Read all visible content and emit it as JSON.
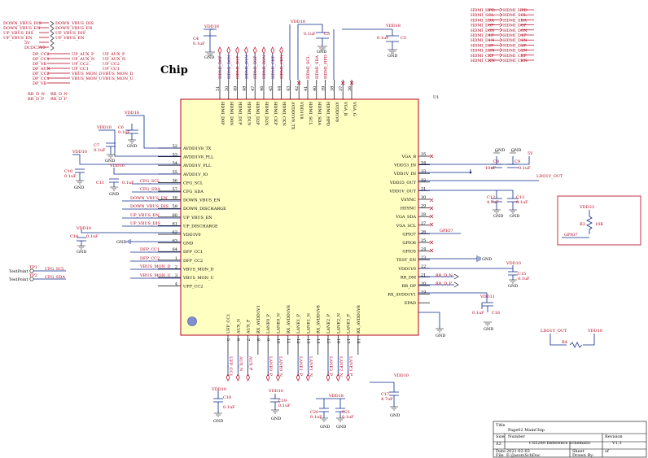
{
  "schematic": {
    "chip_title": "Chip",
    "ref_designator": "U1",
    "left_pins": [
      {
        "num": "52",
        "name": "AVDD1V8_TX"
      },
      {
        "num": "53",
        "name": "AVDD1V8_PLL"
      },
      {
        "num": "54",
        "name": "AVDD1V_PLL"
      },
      {
        "num": "55",
        "name": "AVDD1V_IO"
      },
      {
        "num": "56",
        "name": "CFG_SCL"
      },
      {
        "num": "57",
        "name": "CFG_SDA"
      },
      {
        "num": "58",
        "name": "DOWN_VBUS_EN"
      },
      {
        "num": "59",
        "name": "DOWN_DISCHARGE"
      },
      {
        "num": "60",
        "name": "UP_VBUS_EN"
      },
      {
        "num": "61",
        "name": "UP_DISCHARGE"
      },
      {
        "num": "62",
        "name": "VDD1V0"
      },
      {
        "num": "63",
        "name": "GND"
      },
      {
        "num": "64",
        "name": "DFP_CC1"
      },
      {
        "num": "1",
        "name": "DFP_CC2"
      },
      {
        "num": "2",
        "name": "VBUS_MON_D"
      },
      {
        "num": "3",
        "name": "VBUS_MON_U"
      },
      {
        "num": "4",
        "name": "UFP_CC2"
      }
    ],
    "right_pins": [
      {
        "num": "35",
        "name": "VGA_B"
      },
      {
        "num": "34",
        "name": "VDD33_IN"
      },
      {
        "num": "33",
        "name": "VDD1V_IN"
      },
      {
        "num": "32",
        "name": "VDD33_OUT"
      },
      {
        "num": "31",
        "name": "VDD1V_OUT"
      },
      {
        "num": "30",
        "name": "VSYNC"
      },
      {
        "num": "29",
        "name": "HSYNC"
      },
      {
        "num": "28",
        "name": "VGA_SDA"
      },
      {
        "num": "27",
        "name": "VGA_SCL"
      },
      {
        "num": "26",
        "name": "GPIO7"
      },
      {
        "num": "25",
        "name": "GPIO6"
      },
      {
        "num": "24",
        "name": "GPIO5"
      },
      {
        "num": "23",
        "name": "TEST_EN"
      },
      {
        "num": "22",
        "name": "VDD1V0"
      },
      {
        "num": "21",
        "name": "RR_DM"
      },
      {
        "num": "20",
        "name": "RR_DP"
      },
      {
        "num": "19",
        "name": "RX_AVDD1V1"
      },
      {
        "num": "",
        "name": "EPAD"
      }
    ],
    "top_pins": [
      {
        "num": "51",
        "name": "HDMI_D0P"
      },
      {
        "num": "50",
        "name": "HDMI_D0N"
      },
      {
        "num": "49",
        "name": "HDMI_D1P"
      },
      {
        "num": "48",
        "name": "HDMI_D1N"
      },
      {
        "num": "47",
        "name": "HDMI_D2P"
      },
      {
        "num": "46",
        "name": "HDMI_D2N"
      },
      {
        "num": "45",
        "name": "HDMI_CKP"
      },
      {
        "num": "44",
        "name": "HDMI_CKN"
      },
      {
        "num": "43",
        "name": "AVDD1V8_TX"
      },
      {
        "num": "42",
        "name": "VDD1V8"
      },
      {
        "num": "41",
        "name": "HDMI_SCL"
      },
      {
        "num": "40",
        "name": "HDMI_SDA"
      },
      {
        "num": "39",
        "name": "HDMI_HPD"
      },
      {
        "num": "38",
        "name": "AVDD1V8"
      },
      {
        "num": "37",
        "name": "VGA_R"
      },
      {
        "num": "36",
        "name": "VGA_G"
      }
    ],
    "bottom_pins": [
      {
        "num": "5",
        "name": "UFP_CC1"
      },
      {
        "num": "6",
        "name": "AUX_N"
      },
      {
        "num": "7",
        "name": "AUX_P"
      },
      {
        "num": "8",
        "name": "RX_AVDD1V1"
      },
      {
        "num": "9",
        "name": "LANE0_P"
      },
      {
        "num": "10",
        "name": "LANE0_N"
      },
      {
        "num": "11",
        "name": "RX_AVDD1V8"
      },
      {
        "num": "12",
        "name": "LANE1_P"
      },
      {
        "num": "13",
        "name": "LANE1_N"
      },
      {
        "num": "14",
        "name": "RX_AVDD1V8"
      },
      {
        "num": "15",
        "name": "LANE2_P"
      },
      {
        "num": "16",
        "name": "LANE2_N"
      },
      {
        "num": "17",
        "name": "LANE3_P"
      },
      {
        "num": "18",
        "name": "RX_AVDD1V8"
      }
    ],
    "left_nets": [
      "DOWN_VBUS_DIS",
      "DOWN_VBUS_EN",
      "UP_VBUS_DIS",
      "UP_VBUS_EN",
      "5V",
      "DCDC3V3"
    ],
    "left_nets_2": [
      "DP_CC2",
      "DP_CC1",
      "DP_VB",
      "DP_AUX",
      "UP_AUX_P",
      "UP_AUX_N",
      "UP_CC2",
      "UP_CC1",
      "VBUS_MON_D",
      "VBUS_MON_U"
    ],
    "left_nets_3": [
      "RR_D_N",
      "RR_D_P"
    ],
    "right_nets": [
      "HDMI_HPD",
      "HDMI_SCL",
      "HDMI_SDA",
      "HDMI_D0P",
      "HDMI_D0N",
      "HDMI_D1P",
      "HDMI_D1N",
      "HDMI_D2P",
      "HDMI_D2N",
      "HDMI_CKP",
      "HDMI_CKN"
    ],
    "cfg_nets": [
      "CFG_SCL",
      "CFG_SDA",
      "DOWN_VBUS_EN",
      "DOWN_VBUS_DIS",
      "UP_VBUS_EN",
      "UP_VBUS_DIS"
    ],
    "dfp_nets": [
      "DFP_CC1",
      "DFP_CC2",
      "VBUS_MON_D",
      "VBUS_MON_U"
    ],
    "test_points": [
      {
        "ref": "TP1",
        "label": "TestPoint",
        "net": "CFG_SCL"
      },
      {
        "ref": "TP2",
        "label": "TestPoint",
        "net": "CFG_SDA"
      }
    ],
    "caps": [
      {
        "ref": "C4",
        "value": "0.1uF"
      },
      {
        "ref": "C3",
        "value": "0.1uF"
      },
      {
        "ref": "C5",
        "value": "0.1uF"
      },
      {
        "ref": "C6",
        "value": "0.1uF"
      },
      {
        "ref": "C7",
        "value": "0.1uF"
      },
      {
        "ref": "C10",
        "value": "0.1uF"
      },
      {
        "ref": "C11",
        "value": "0.1uF"
      },
      {
        "ref": "C14",
        "value": "0.1uF"
      },
      {
        "ref": "C8",
        "value": "10uF"
      },
      {
        "ref": "C9",
        "value": "0.1uF"
      },
      {
        "ref": "C12",
        "value": "4.7uF"
      },
      {
        "ref": "C13",
        "value": "0.1uF"
      },
      {
        "ref": "C15",
        "value": "0.1uF"
      },
      {
        "ref": "C16",
        "value": "0.1uF"
      },
      {
        "ref": "C17",
        "value": "4.7uF"
      },
      {
        "ref": "C18",
        "value": "0.1uF"
      },
      {
        "ref": "C19",
        "value": "0.1uF"
      },
      {
        "ref": "C20",
        "value": "0.1uF"
      },
      {
        "ref": "C21",
        "value": "0.1uF"
      }
    ],
    "power": [
      "VDD18",
      "VDD10",
      "VDD33",
      "VDD11",
      "5V",
      "GND"
    ],
    "resistor": {
      "ref": "R3",
      "value": "10K",
      "net": "GPIO7",
      "rail": "VDD33"
    },
    "ldo": {
      "ref": "R4",
      "net_in": "LDO1V_OUT",
      "net_out": "VDD10"
    },
    "ldo_out_label": "LDO1V_OUT",
    "gpio_label": "GPIO7",
    "title_block": {
      "title_label": "Title",
      "title": "Page02 MainChip",
      "size_label": "Size",
      "size": "A3",
      "number_label": "Number",
      "number": "CS5269 Reference Schematic",
      "revision_label": "Revision",
      "revision": "V1.3",
      "date_label": "Date",
      "date": "2021-02-03",
      "sheet_label": "Sheet",
      "of_label": "of",
      "file_label": "File",
      "file": "E:\\Jason\\SchDoc",
      "drawn_label": "Drawn By:"
    }
  }
}
